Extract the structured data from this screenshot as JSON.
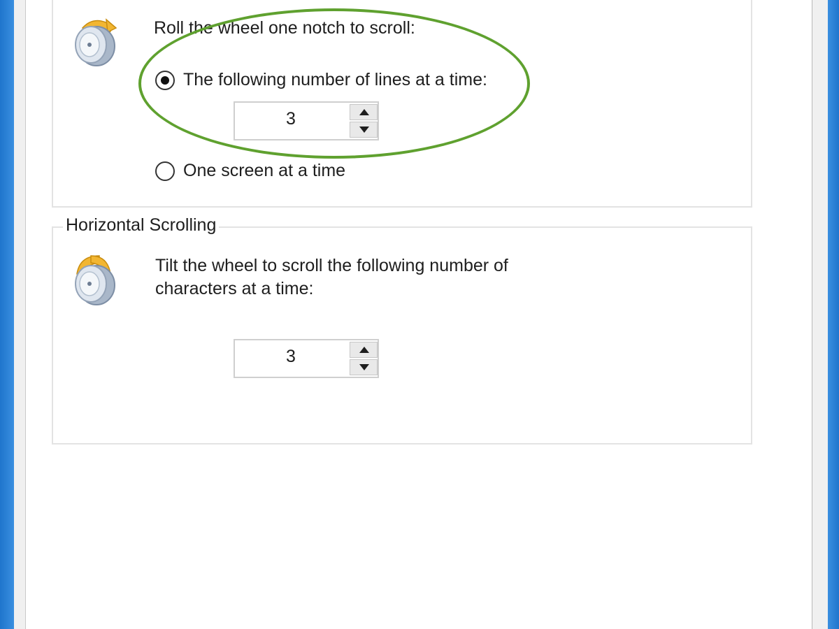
{
  "vertical_scrolling": {
    "description": "Roll the wheel one notch to scroll:",
    "option_lines_label": "The following number of lines at a time:",
    "option_lines_selected": true,
    "lines_value": "3",
    "option_screen_label": "One screen at a time",
    "option_screen_selected": false
  },
  "horizontal_scrolling": {
    "title": "Horizontal Scrolling",
    "description_line1": "Tilt the wheel to scroll the following number of",
    "description_line2": "characters at a time:",
    "chars_value": "3"
  },
  "icons": {
    "vertical": "mouse-wheel-icon",
    "horizontal": "mouse-wheel-tilt-icon",
    "spin_up": "arrow-up-icon",
    "spin_down": "arrow-down-icon"
  },
  "colors": {
    "window_frame": "#2f84d8",
    "highlight": "#5fa12f",
    "wheel_accent": "#f2b632"
  }
}
